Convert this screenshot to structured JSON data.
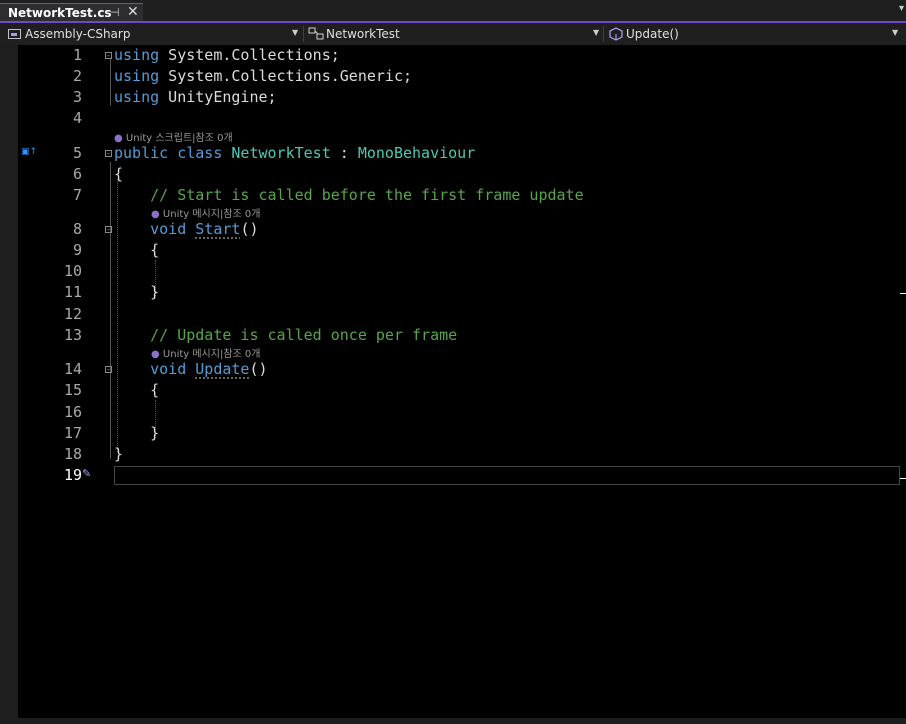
{
  "tab": {
    "title": "NetworkTest.cs",
    "pin_glyph": "⊣",
    "close_glyph": "✕",
    "overflow_glyph": "▾"
  },
  "nav": {
    "project": {
      "label": "Assembly-CSharp",
      "icon": "csharp-project-icon"
    },
    "type": {
      "label": "NetworkTest",
      "icon": "class-icon"
    },
    "member": {
      "label": "Update()",
      "icon": "method-icon"
    },
    "dropdown_glyph": "▼"
  },
  "editor": {
    "lines": [
      {
        "num": "1",
        "tokens": [
          [
            "kw",
            "using"
          ],
          [
            "tx",
            " System.Collections;"
          ]
        ]
      },
      {
        "num": "2",
        "tokens": [
          [
            "kw",
            "using"
          ],
          [
            "tx",
            " System.Collections.Generic;"
          ]
        ]
      },
      {
        "num": "3",
        "tokens": [
          [
            "kw",
            "using"
          ],
          [
            "tx",
            " UnityEngine;"
          ]
        ]
      },
      {
        "num": "4",
        "tokens": []
      },
      {
        "num": "5",
        "tokens": [
          [
            "kw",
            "public"
          ],
          [
            "tx",
            " "
          ],
          [
            "kw",
            "class"
          ],
          [
            "tx",
            " "
          ],
          [
            "ty",
            "NetworkTest"
          ],
          [
            "tx",
            " : "
          ],
          [
            "ty",
            "MonoBehaviour"
          ]
        ]
      },
      {
        "num": "6",
        "tokens": [
          [
            "tx",
            "{"
          ]
        ]
      },
      {
        "num": "7",
        "tokens": [
          [
            "tx",
            "    "
          ],
          [
            "cm",
            "// Start is called before the first frame update"
          ]
        ]
      },
      {
        "num": "8",
        "tokens": [
          [
            "tx",
            "    "
          ],
          [
            "kw",
            "void"
          ],
          [
            "tx",
            " "
          ],
          [
            "fn",
            "Start"
          ],
          [
            "tx",
            "()"
          ]
        ]
      },
      {
        "num": "9",
        "tokens": [
          [
            "tx",
            "    {"
          ]
        ]
      },
      {
        "num": "10",
        "tokens": []
      },
      {
        "num": "11",
        "tokens": [
          [
            "tx",
            "    }"
          ]
        ]
      },
      {
        "num": "12",
        "tokens": []
      },
      {
        "num": "13",
        "tokens": [
          [
            "tx",
            "    "
          ],
          [
            "cm",
            "// Update is called once per frame"
          ]
        ]
      },
      {
        "num": "14",
        "tokens": [
          [
            "tx",
            "    "
          ],
          [
            "kw",
            "void"
          ],
          [
            "tx",
            " "
          ],
          [
            "fn",
            "Update"
          ],
          [
            "tx",
            "()"
          ]
        ]
      },
      {
        "num": "15",
        "tokens": [
          [
            "tx",
            "    {"
          ]
        ]
      },
      {
        "num": "16",
        "tokens": []
      },
      {
        "num": "17",
        "tokens": [
          [
            "tx",
            "    }"
          ]
        ]
      },
      {
        "num": "18",
        "tokens": [
          [
            "tx",
            "}"
          ]
        ]
      },
      {
        "num": "19",
        "tokens": []
      }
    ],
    "codelens": {
      "class": "Unity 스크립트|참조 0개",
      "start": "Unity 메시지|참조 0개",
      "update": "Unity 메시지|참조 0개"
    },
    "fold_glyph": "⊟"
  },
  "colors": {
    "accent": "#6b4bc9",
    "keyword": "#569cd6",
    "type": "#4ec9b0",
    "comment": "#57a64a",
    "editor_bg": "#000000"
  }
}
